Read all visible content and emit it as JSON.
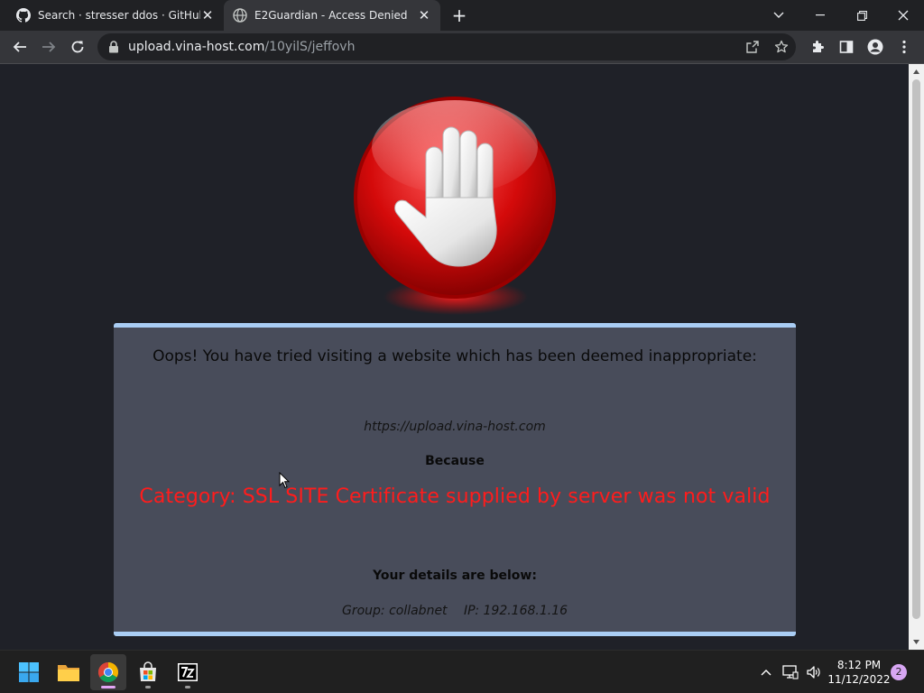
{
  "browser": {
    "tabs": [
      {
        "title": "Search · stresser ddos · GitHub",
        "favicon": "github-icon",
        "active": false
      },
      {
        "title": "E2Guardian - Access Denied",
        "favicon": "globe-icon",
        "active": true
      }
    ],
    "address_bar": {
      "host": "upload.vina-host.com",
      "path": "/10yilS/jeffovh"
    }
  },
  "page": {
    "heading": "Oops! You have tried visiting a website which has been deemed inappropriate:",
    "blocked_url": "https://upload.vina-host.com",
    "because_label": "Because",
    "reason": "Category: SSL SITE  Certificate supplied by server was not valid",
    "details_label": "Your details are below:",
    "group": "Group: collabnet",
    "ip": "IP: 192.168.1.16",
    "colors": {
      "background": "#1f2128",
      "panel": "#484c5a",
      "panel_border": "#a9cdf4",
      "reason_text": "#ff1c1c"
    }
  },
  "taskbar": {
    "apps": [
      "start-icon",
      "file-explorer-icon",
      "chrome-icon",
      "microsoft-store-icon",
      "7zip-icon"
    ],
    "clock": {
      "time": "8:12 PM",
      "date": "11/12/2022"
    },
    "notifications": "2"
  }
}
